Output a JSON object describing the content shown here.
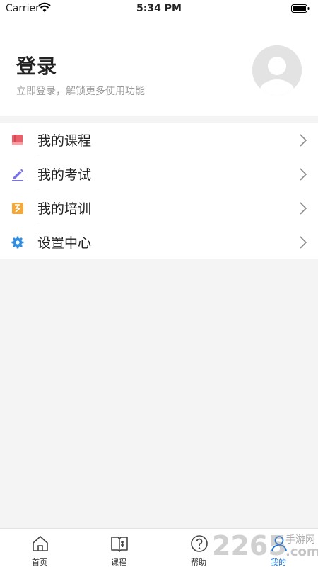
{
  "status_bar": {
    "carrier": "Carrier",
    "time": "5:34 PM"
  },
  "header": {
    "title": "登录",
    "subtitle": "立即登录，解锁更多使用功能"
  },
  "menu": {
    "items": [
      {
        "label": "我的课程",
        "icon": "course-book-icon",
        "color": "#e8606a"
      },
      {
        "label": "我的考试",
        "icon": "pencil-icon",
        "color": "#7b74e8"
      },
      {
        "label": "我的培训",
        "icon": "training-icon",
        "color": "#f2a83a"
      },
      {
        "label": "设置中心",
        "icon": "gear-icon",
        "color": "#2f8ee0"
      }
    ]
  },
  "tabbar": {
    "tabs": [
      {
        "label": "首页",
        "icon": "home-icon",
        "active": false
      },
      {
        "label": "课程",
        "icon": "book-icon",
        "active": false
      },
      {
        "label": "帮助",
        "icon": "help-icon",
        "active": false
      },
      {
        "label": "我的",
        "icon": "user-icon",
        "active": true
      }
    ],
    "active_color": "#1b6fd8"
  },
  "watermark": {
    "number": "2265",
    "text_top": "手游网",
    "text_bottom": ".com"
  }
}
